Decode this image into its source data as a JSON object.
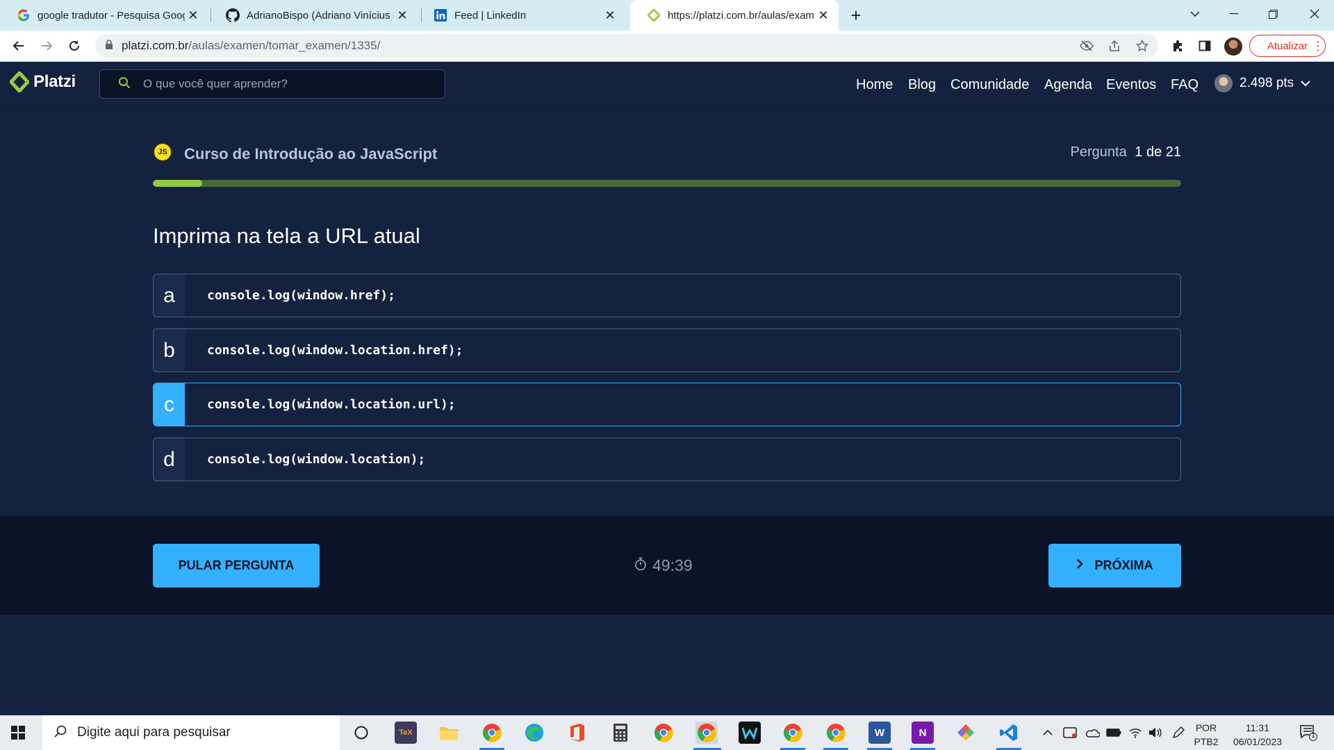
{
  "browser": {
    "tabs": [
      {
        "title": "google tradutor - Pesquisa Goog",
        "icon": "google-icon",
        "active": false
      },
      {
        "title": "AdrianoBispo (Adriano Vinícius B",
        "icon": "github-icon",
        "active": false
      },
      {
        "title": "Feed | LinkedIn",
        "icon": "linkedin-icon",
        "active": false
      },
      {
        "title": "https://platzi.com.br/aulas/exam",
        "icon": "platzi-icon",
        "active": true
      }
    ],
    "url_host": "platzi.com.br",
    "url_path": "/aulas/examen/tomar_examen/1335/",
    "update_label": "Atualizar"
  },
  "header": {
    "logo_text": "Platzi",
    "search_placeholder": "O que você quer aprender?",
    "nav": [
      "Home",
      "Blog",
      "Comunidade",
      "Agenda",
      "Eventos",
      "FAQ"
    ],
    "points": "2.498 pts"
  },
  "exam": {
    "course_badge": "JS",
    "course_title": "Curso de Introdução ao JavaScript",
    "question_label": "Pergunta",
    "question_counter": "1 de 21",
    "progress_fraction": 0.048,
    "question": "Imprima na tela a URL atual",
    "options": [
      {
        "letter": "a",
        "code": "console.log(window.href);",
        "selected": false
      },
      {
        "letter": "b",
        "code": "console.log(window.location.href);",
        "selected": false
      },
      {
        "letter": "c",
        "code": "console.log(window.location.url);",
        "selected": true
      },
      {
        "letter": "d",
        "code": "console.log(window.location);",
        "selected": false
      }
    ],
    "skip_label": "PULAR PERGUNTA",
    "timer": "49:39",
    "next_label": "PRÓXIMA"
  },
  "taskbar": {
    "search_placeholder": "Digite aqui para pesquisar",
    "language": [
      "POR",
      "PTB2"
    ],
    "time": "11:31",
    "date": "06/01/2023",
    "notification_count": "1"
  },
  "colors": {
    "page_bg": "#13233f",
    "accent": "#33b1ff",
    "progress": "#98ca3f"
  }
}
